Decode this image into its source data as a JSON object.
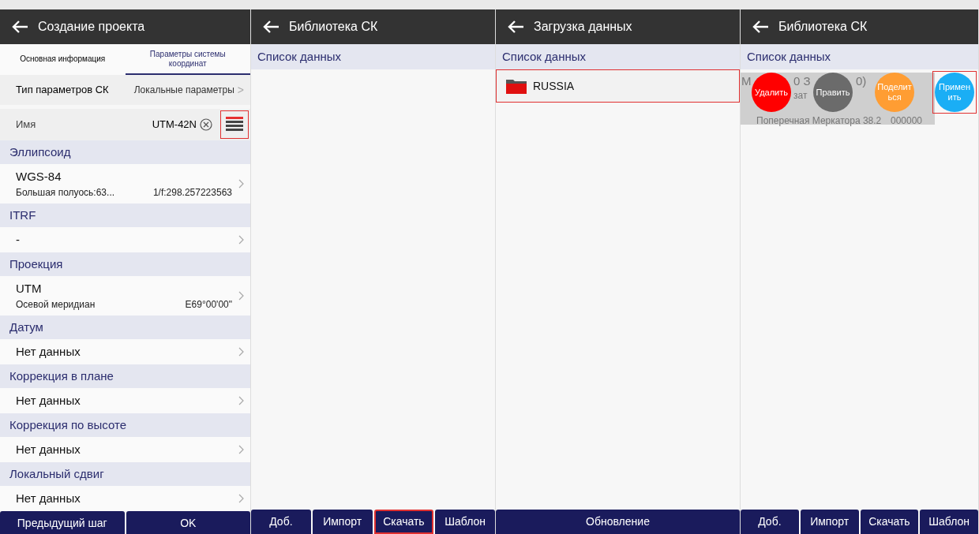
{
  "panels": [
    {
      "kind": "form",
      "title": "Создание проекта",
      "tabs": [
        {
          "label": "Основная информация",
          "selected": false
        },
        {
          "label": "Параметры системы координат",
          "selected": true
        }
      ],
      "type_row": {
        "label": "Тип параметров СК",
        "value": "Локальные параметры",
        "chevron": ">"
      },
      "name_row": {
        "label": "Имя",
        "value": "UTM-42N",
        "list_button_highlighted": true
      },
      "sections": [
        {
          "header": "Эллипсоид",
          "title": "WGS-84",
          "sub_left": "Большая полуось:63...",
          "sub_right": "1/f:298.257223563"
        },
        {
          "header": "ITRF",
          "title": "-"
        },
        {
          "header": "Проекция",
          "title": "UTM",
          "sub_left": "Осевой меридиан",
          "sub_right": "E69°00'00\""
        },
        {
          "header": "Датум",
          "title": "Нет данных"
        },
        {
          "header": "Коррекция в плане",
          "title": "Нет данных"
        },
        {
          "header": "Коррекция по высоте",
          "title": "Нет данных"
        },
        {
          "header": "Локальный сдвиг",
          "title": "Нет данных"
        }
      ],
      "buttons": [
        {
          "label": "Предыдущий шаг",
          "highlighted": false
        },
        {
          "label": "OK",
          "highlighted": false
        }
      ]
    },
    {
      "kind": "empty",
      "title": "Библиотека СК",
      "list_header": "Список данных",
      "buttons": [
        {
          "label": "Доб.",
          "highlighted": false
        },
        {
          "label": "Импорт",
          "highlighted": false
        },
        {
          "label": "Скачать",
          "highlighted": true
        },
        {
          "label": "Шаблон",
          "highlighted": false
        }
      ]
    },
    {
      "kind": "folders",
      "title": "Загрузка данных",
      "list_header": "Список данных",
      "items": [
        {
          "name": "RUSSIA",
          "highlighted": true
        }
      ],
      "buttons": [
        {
          "label": "Обновление",
          "highlighted": false
        }
      ]
    },
    {
      "kind": "swipe",
      "title": "Библиотека СК",
      "list_header": "Список данных",
      "item_fragments": [
        [
          "М",
          "0 З",
          "0)"
        ],
        [
          "зат"
        ],
        [
          "Поперечная Меркатора 38.2",
          "000000"
        ]
      ],
      "actions": [
        {
          "label": "Удалить",
          "color": "#ff0000",
          "highlighted": false
        },
        {
          "label": "Править",
          "color": "#6b6b6b",
          "highlighted": false
        },
        {
          "label": "Поделиться",
          "color": "#ff9d33",
          "highlighted": false
        },
        {
          "label": "Применить",
          "color": "#1aaef5",
          "highlighted": true
        }
      ],
      "buttons": [
        {
          "label": "Доб.",
          "highlighted": false
        },
        {
          "label": "Импорт",
          "highlighted": false
        },
        {
          "label": "Скачать",
          "highlighted": false
        },
        {
          "label": "Шаблон",
          "highlighted": false
        }
      ]
    }
  ]
}
